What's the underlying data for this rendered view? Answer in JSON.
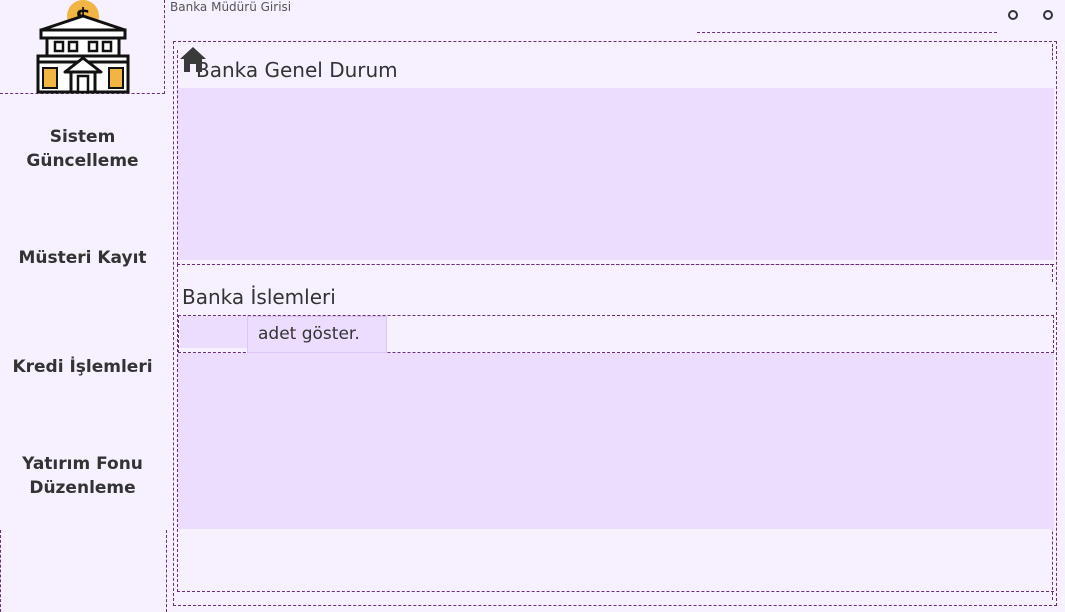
{
  "window": {
    "title": "Banka Müdürü Girisi"
  },
  "sidebar": {
    "logo": "bank-logo-icon",
    "items": [
      {
        "label_line1": "Sistem",
        "label_line2": "Güncelleme"
      },
      {
        "label_line1": "Müsteri Kayıt"
      },
      {
        "label_line1": "Kredi İşlemleri"
      },
      {
        "label_line1": "Yatırım Fonu",
        "label_line2": "Düzenleme"
      }
    ]
  },
  "main": {
    "home_icon": "home-icon",
    "section1_title": "Banka Genel Durum",
    "section2_title": "Banka İslemleri",
    "show_button": "adet göster."
  },
  "colors": {
    "panel": "#ecdcfd",
    "background": "#f6f0ff",
    "logo_gold": "#f0b542"
  }
}
